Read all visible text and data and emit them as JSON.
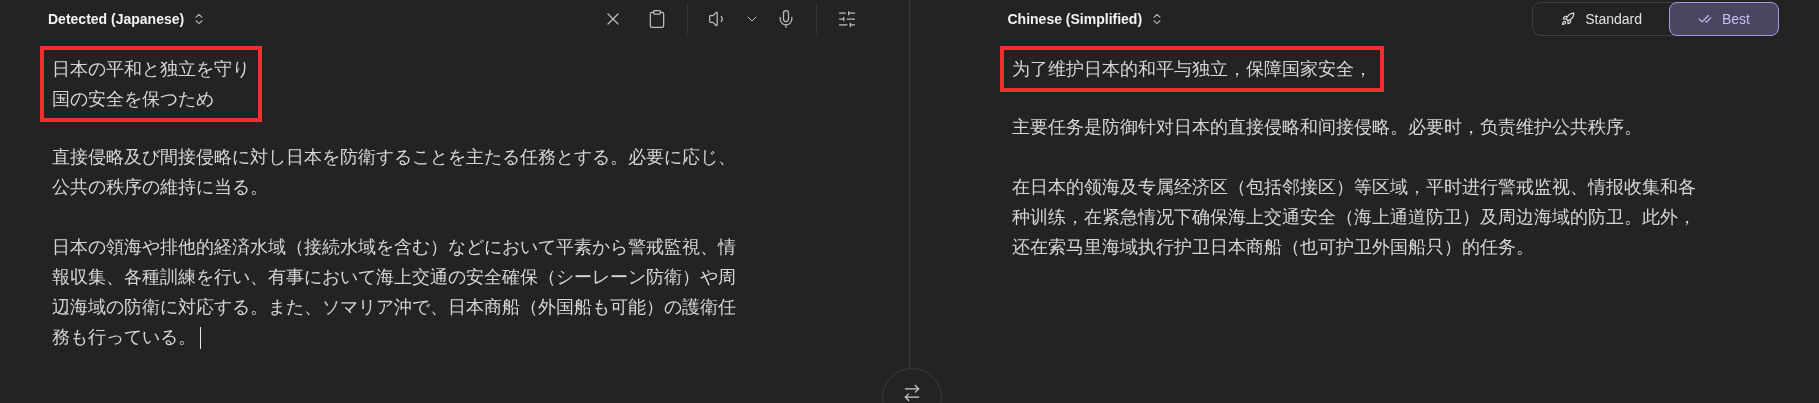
{
  "source": {
    "language": "Detected (Japanese)",
    "paragraphs": [
      {
        "highlighted": true,
        "lines": [
          "日本の平和と独立を守り",
          "国の安全を保つため"
        ]
      },
      {
        "highlighted": false,
        "lines": [
          "直接侵略及び間接侵略に対し日本を防衛することを主たる任務とする。必要に応じ、",
          "公共の秩序の維持に当る。"
        ]
      },
      {
        "highlighted": false,
        "lines": [
          "日本の領海や排他的経済水域（接続水域を含む）などにおいて平素から警戒監視、情",
          "報収集、各種訓練を行い、有事において海上交通の安全確保（シーレーン防衛）や周",
          "辺海域の防衛に対応する。また、ソマリア沖で、日本商船（外国船も可能）の護衛任",
          "務も行っている。"
        ]
      }
    ]
  },
  "target": {
    "language": "Chinese (Simplified)",
    "modes": [
      {
        "label": "Standard",
        "kind": "standard",
        "selected": false
      },
      {
        "label": "Best",
        "kind": "best",
        "selected": true
      }
    ],
    "paragraphs": [
      {
        "highlighted": true,
        "lines": [
          "为了维护日本的和平与独立，保障国家安全，"
        ]
      },
      {
        "highlighted": false,
        "lines": [
          "主要任务是防御针对日本的直接侵略和间接侵略。必要时，负责维护公共秩序。"
        ]
      },
      {
        "highlighted": false,
        "lines": [
          "在日本的领海及专属经济区（包括邻接区）等区域，平时进行警戒监视、情报收集和各",
          "种训练，在紧急情况下确保海上交通安全（海上通道防卫）及周边海域的防卫。此外，",
          "还在索马里海域执行护卫日本商船（也可护卫外国船只）的任务。"
        ]
      }
    ]
  }
}
